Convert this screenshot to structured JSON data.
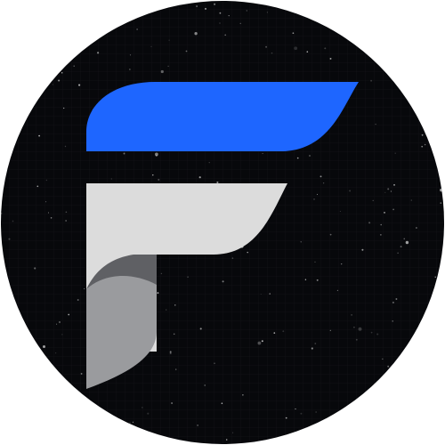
{
  "logo": {
    "icon_name": "f-logo-icon",
    "colors": {
      "badge_background": "#07080b",
      "top_bar": "#1e66ff",
      "middle_bar": "#dcdcdc",
      "stem_light": "#9a9b9e",
      "stem_shadow": "#5f6064",
      "stars": "#ffffff"
    }
  }
}
